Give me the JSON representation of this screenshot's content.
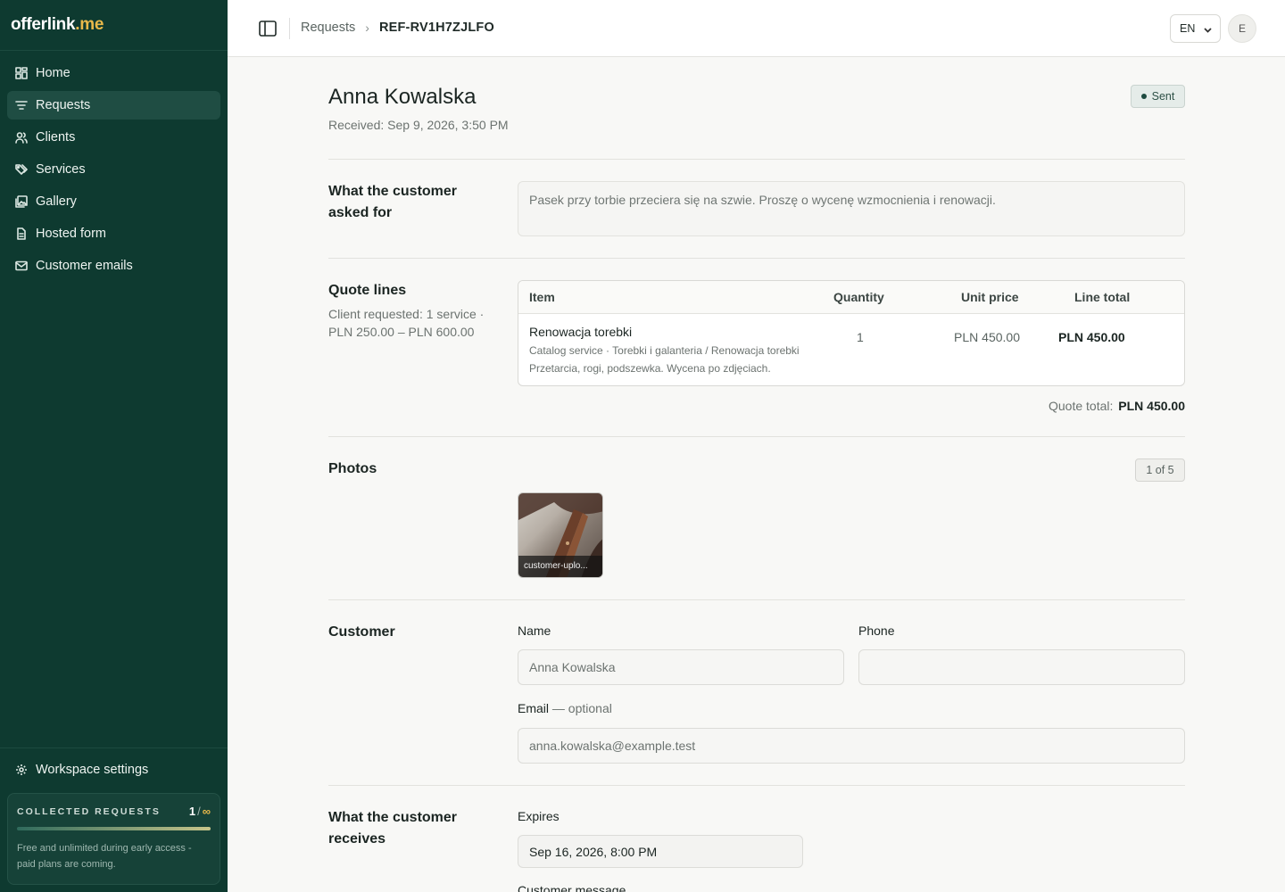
{
  "brand": {
    "part1": "offerlink",
    "part2": ".me"
  },
  "sidebar": {
    "items": [
      {
        "label": "Home",
        "icon": "grid-icon"
      },
      {
        "label": "Requests",
        "icon": "filter-icon"
      },
      {
        "label": "Clients",
        "icon": "users-icon"
      },
      {
        "label": "Services",
        "icon": "tags-icon"
      },
      {
        "label": "Gallery",
        "icon": "gallery-icon"
      },
      {
        "label": "Hosted form",
        "icon": "document-icon"
      },
      {
        "label": "Customer emails",
        "icon": "mail-icon"
      }
    ],
    "active_index": 1,
    "settings_label": "Workspace settings",
    "usage": {
      "label": "COLLECTED REQUESTS",
      "count": "1",
      "separator": "/",
      "limit": "∞",
      "note": "Free and unlimited during early access - paid plans are coming."
    }
  },
  "topbar": {
    "breadcrumb_parent": "Requests",
    "breadcrumb_current": "REF-RV1H7ZJLFO",
    "language": "EN",
    "avatar_initial": "E"
  },
  "request": {
    "customer_name": "Anna Kowalska",
    "received": "Received: Sep 9, 2026, 3:50 PM",
    "status": "Sent",
    "status_color": "#1e4b40"
  },
  "asked": {
    "title": "What the customer asked for",
    "text": "Pasek przy torbie przeciera się na szwie. Proszę o wycenę wzmocnienia i renowacji."
  },
  "quote": {
    "title": "Quote lines",
    "subtitle": "Client requested: 1 service · PLN 250.00 – PLN 600.00",
    "columns": {
      "item": "Item",
      "quantity": "Quantity",
      "unit_price": "Unit price",
      "line_total": "Line total"
    },
    "lines": [
      {
        "name": "Renowacja torebki",
        "meta": "Catalog service · Torebki i galanteria / Renowacja torebki",
        "description": "Przetarcia, rogi, podszewka. Wycena po zdjęciach.",
        "quantity": "1",
        "unit_price": "PLN 450.00",
        "line_total": "PLN 450.00"
      }
    ],
    "total_label": "Quote total:",
    "total_value": "PLN 450.00"
  },
  "photos": {
    "title": "Photos",
    "count": "1 of 5",
    "items": [
      {
        "caption": "customer-uplo..."
      }
    ]
  },
  "customer": {
    "title": "Customer",
    "name_label": "Name",
    "name_value": "Anna Kowalska",
    "phone_label": "Phone",
    "phone_value": "",
    "email_label": "Email",
    "email_optional": " — optional",
    "email_value": "anna.kowalska@example.test"
  },
  "receives": {
    "title": "What the customer receives",
    "expires_label": "Expires",
    "expires_value": "Sep 16, 2026, 8:00 PM",
    "message_label": "Customer message"
  }
}
